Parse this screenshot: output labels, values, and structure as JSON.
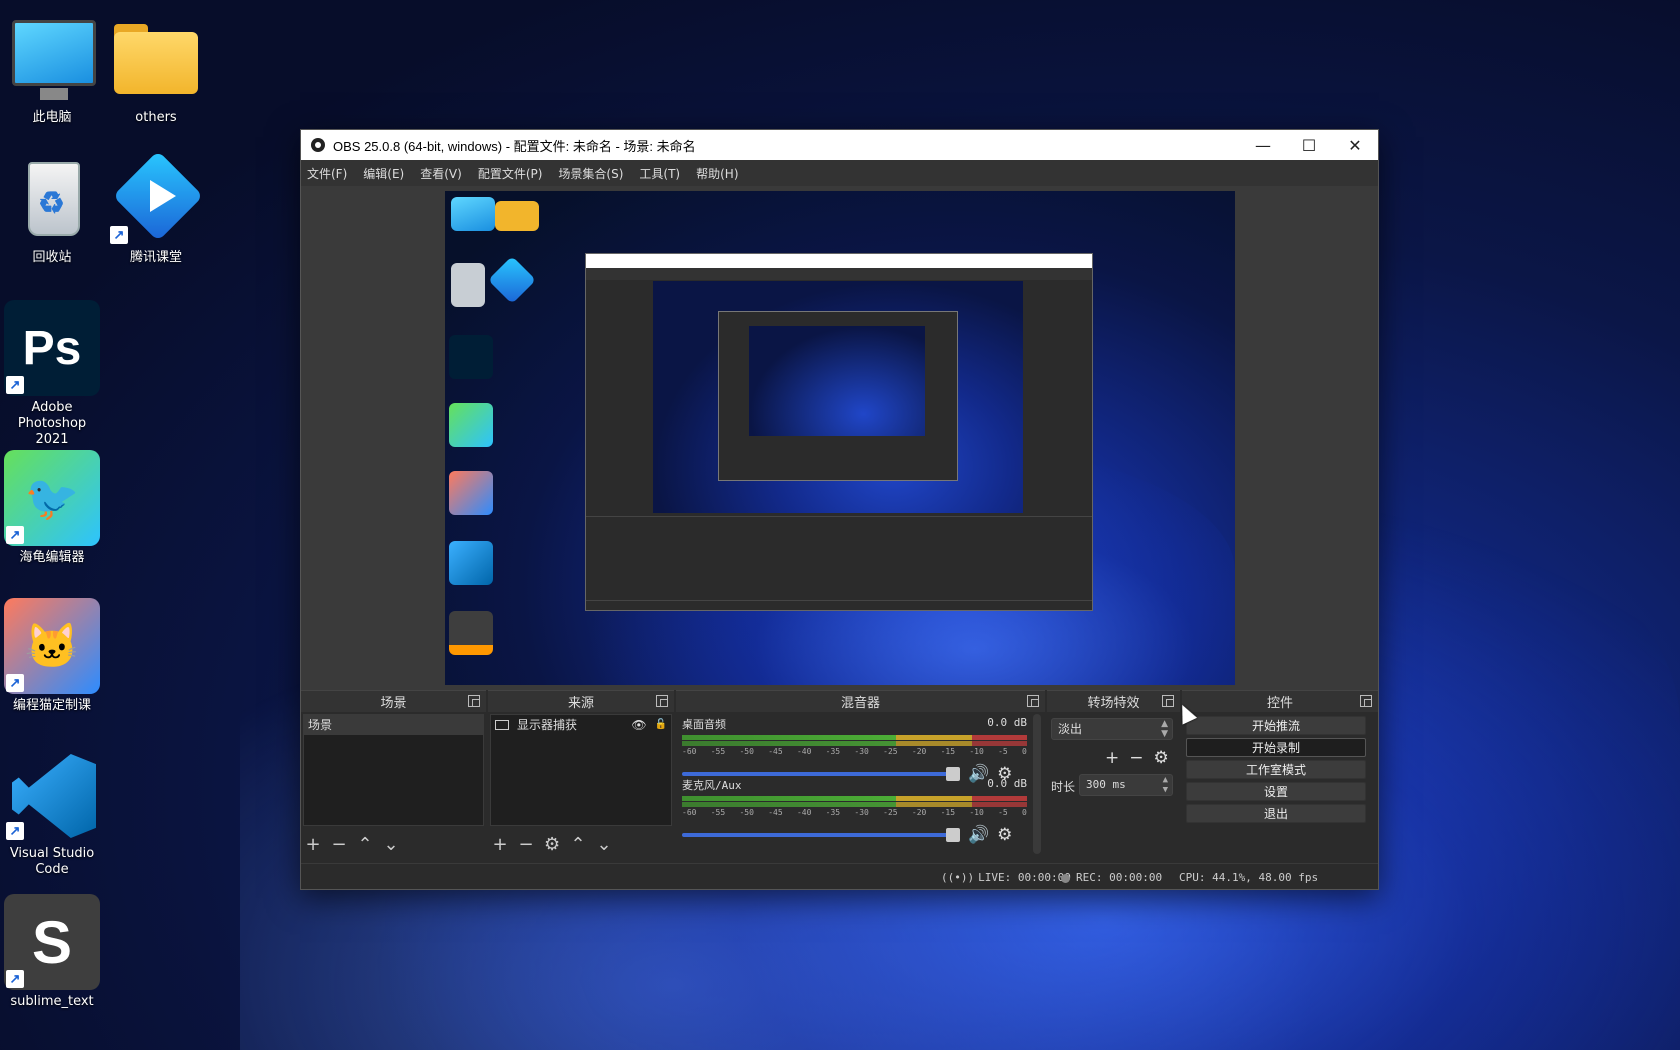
{
  "desktop": {
    "icons": [
      {
        "label": "此电脑",
        "icon": "computer-icon"
      },
      {
        "label": "others",
        "icon": "folder-icon"
      },
      {
        "label": "回收站",
        "icon": "recycle-bin-icon"
      },
      {
        "label": "腾讯课堂",
        "icon": "tencent-classroom-icon"
      },
      {
        "label": "Adobe Photoshop 2021",
        "icon": "photoshop-icon"
      },
      {
        "label": "海龟编辑器",
        "icon": "turtle-editor-icon"
      },
      {
        "label": "编程猫定制课",
        "icon": "codemao-icon"
      },
      {
        "label": "Visual Studio Code",
        "icon": "vscode-icon"
      },
      {
        "label": "sublime_text",
        "icon": "sublime-text-icon"
      }
    ]
  },
  "window": {
    "title": "OBS 25.0.8 (64-bit, windows) - 配置文件: 未命名 - 场景: 未命名",
    "minimize": "—",
    "maximize": "☐",
    "close": "✕"
  },
  "menu": [
    "文件(F)",
    "编辑(E)",
    "查看(V)",
    "配置文件(P)",
    "场景集合(S)",
    "工具(T)",
    "帮助(H)"
  ],
  "scenes": {
    "header": "场景",
    "items": [
      "场景"
    ]
  },
  "sources": {
    "header": "来源",
    "items": [
      {
        "label": "显示器捕获",
        "visible": true,
        "locked": false
      }
    ]
  },
  "mixer": {
    "header": "混音器",
    "channels": [
      {
        "name": "桌面音频",
        "level": "0.0 dB",
        "volume": 1.0
      },
      {
        "name": "麦克风/Aux",
        "level": "0.0 dB",
        "volume": 1.0
      }
    ],
    "ticks": [
      "-60",
      "-55",
      "-50",
      "-45",
      "-40",
      "-35",
      "-30",
      "-25",
      "-20",
      "-15",
      "-10",
      "-5",
      "0"
    ]
  },
  "transitions": {
    "header": "转场特效",
    "selected": "淡出",
    "duration_label": "时长",
    "duration_value": "300 ms"
  },
  "controls": {
    "header": "控件",
    "buttons": [
      "开始推流",
      "开始录制",
      "工作室模式",
      "设置",
      "退出"
    ]
  },
  "status": {
    "live": "LIVE: 00:00:00",
    "rec": "REC: 00:00:00",
    "cpu": "CPU: 44.1%, 48.00 fps"
  },
  "colors": {
    "accent": "#3d6ad8",
    "panel": "#2b2b2b",
    "meter_green": "#4cae36",
    "meter_yellow": "#c7a22a",
    "meter_red": "#b23a3a"
  }
}
